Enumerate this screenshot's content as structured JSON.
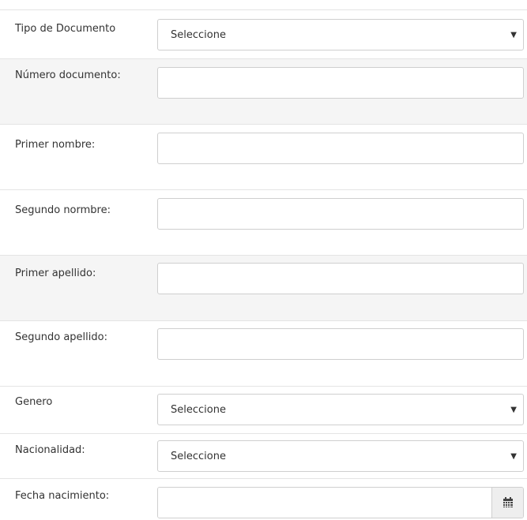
{
  "fields": {
    "tipo_documento": {
      "label": "Tipo de Documento",
      "selected": "Seleccione"
    },
    "numero_documento": {
      "label": "Número documento:",
      "value": ""
    },
    "primer_nombre": {
      "label": "Primer nombre:",
      "value": ""
    },
    "segundo_nombre": {
      "label": "Segundo normbre:",
      "value": ""
    },
    "primer_apellido": {
      "label": "Primer apellido:",
      "value": ""
    },
    "segundo_apellido": {
      "label": "Segundo apellido:",
      "value": ""
    },
    "genero": {
      "label": "Genero",
      "selected": "Seleccione"
    },
    "nacionalidad": {
      "label": "Nacionalidad:",
      "selected": "Seleccione"
    },
    "fecha_nacimiento": {
      "label": "Fecha nacimiento:",
      "value": "",
      "icon": "calendar-icon"
    }
  },
  "colors": {
    "row_shade": "#f5f5f5",
    "border": "#cfcfcf",
    "divider": "#e4e4e4",
    "text": "#333333"
  }
}
